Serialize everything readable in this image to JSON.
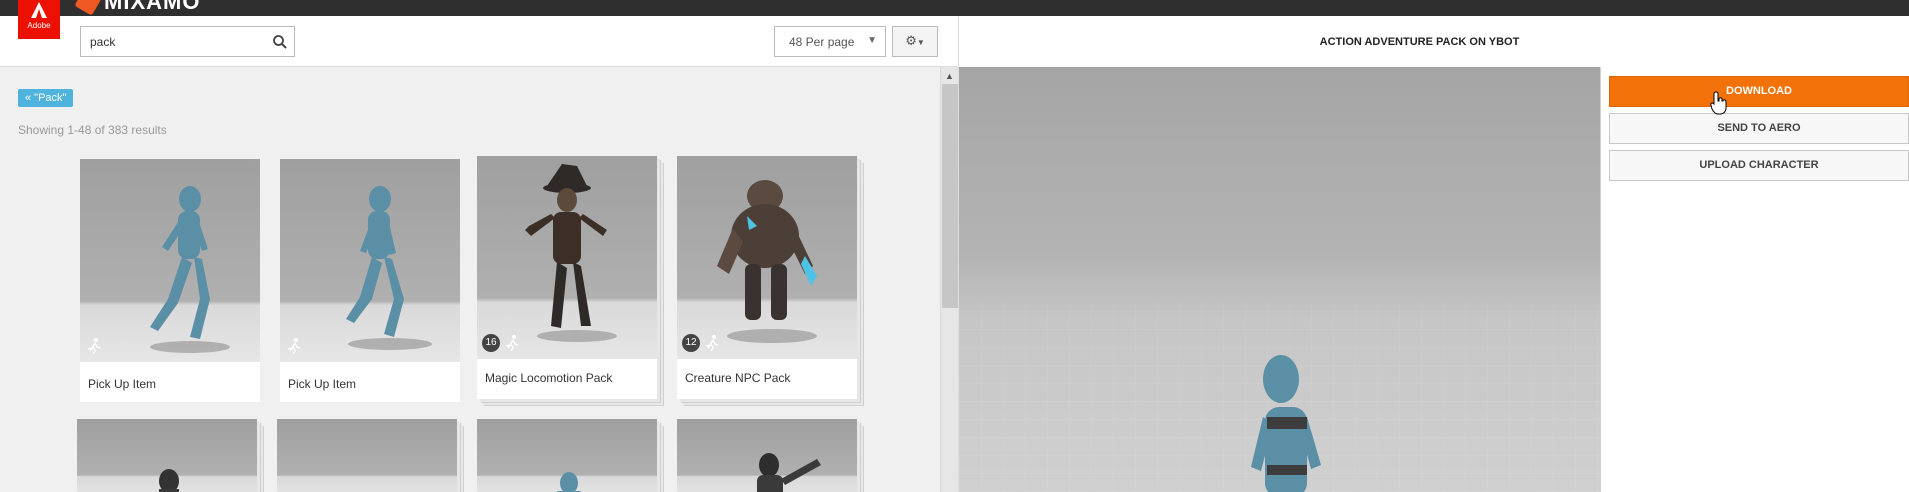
{
  "header": {
    "adobe_label": "Adobe",
    "brand_name": "MIXAMO"
  },
  "toolbar": {
    "search_value": "pack",
    "per_page": "48 Per page"
  },
  "filter": {
    "tag": "« \"Pack\""
  },
  "results_text": "Showing 1-48 of 383 results",
  "cards": [
    {
      "label": "Pick Up Item"
    },
    {
      "label": "Pick Up Item"
    },
    {
      "label": "Magic Locomotion Pack",
      "count": "16"
    },
    {
      "label": "Creature NPC Pack",
      "count": "12"
    }
  ],
  "preview": {
    "title": "ACTION ADVENTURE PACK ON YBOT",
    "download_label": "DOWNLOAD",
    "send_label": "SEND TO AERO",
    "upload_label": "UPLOAD CHARACTER"
  },
  "colors": {
    "accent": "#f27209",
    "tag": "#4eb3dd",
    "adobe_red": "#eb1000"
  }
}
